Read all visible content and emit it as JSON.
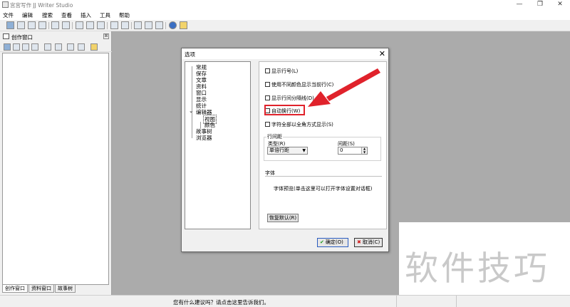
{
  "window": {
    "title": "宫宫写作 JJ Writer Studio",
    "minimize": "—",
    "maximize": "❐",
    "close": "✕"
  },
  "menu": [
    "文件",
    "编辑",
    "搜索",
    "查看",
    "插入",
    "工具",
    "帮助"
  ],
  "left_panel": {
    "title": "创作窗口",
    "pin": "⊠",
    "tabs": [
      "创作窗口",
      "资料窗口",
      "故事树"
    ]
  },
  "status": {
    "hint": "您有什么建议吗？请点击这里告诉我们。"
  },
  "watermark": "软件技巧",
  "dialog": {
    "title": "选项",
    "close": "✕",
    "tree": [
      "常规",
      "保存",
      "文章",
      "资料",
      "窗口",
      "显示",
      "统计",
      "编辑器",
      "视图",
      "颜色",
      "故事树",
      "浏览器"
    ],
    "tree_expander": "⌄",
    "checkboxes": {
      "line_numbers": "显示行号(L)",
      "highlight_line": "使用不同颜色显示当前行(C)",
      "row_sep": "显示行间分隔线(D)",
      "word_wrap": "自动换行(W)",
      "fullwidth": "字符全部以全角方式显示(S)"
    },
    "spacing": {
      "group": "行间距",
      "type_label": "类型(R)",
      "type_value": "单倍行距",
      "gap_label": "间距(S)",
      "gap_value": "0"
    },
    "font": {
      "label": "字体",
      "preview": "字体预览(单击这里可以打开字体设置对话框)"
    },
    "restore": "恢复默认(R)",
    "ok": "确定(O)",
    "ok_icon": "✔",
    "cancel": "取消(C)",
    "cancel_icon": "✖"
  }
}
